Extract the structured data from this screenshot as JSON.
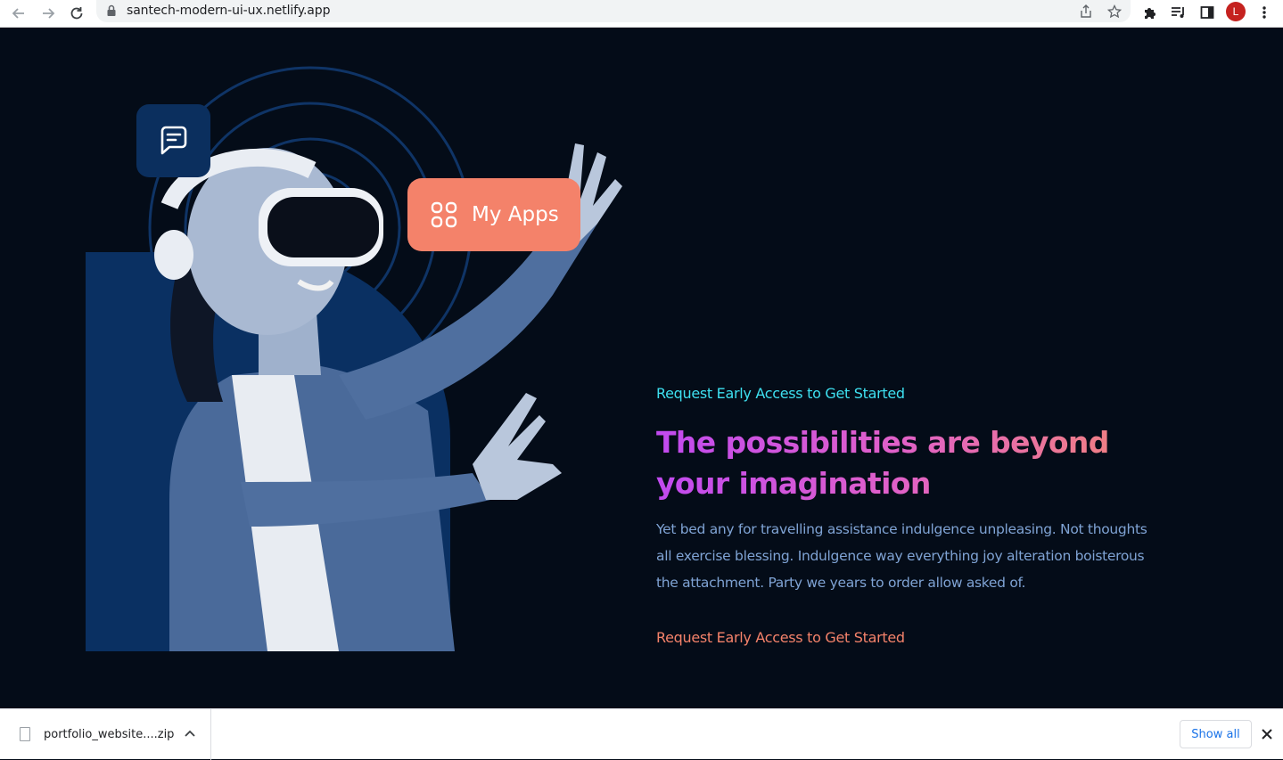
{
  "browser": {
    "url": "santech-modern-ui-ux.netlify.app",
    "profile_initial": "L"
  },
  "hero": {
    "chip_label": "My Apps",
    "eyebrow": "Request Early Access to Get Started",
    "headline": "The possibilities are beyond your imagination",
    "body": "Yet bed any for travelling assistance indulgence unpleasing. Not thoughts all exercise blessing. Indulgence way everything joy alteration boisterous the attachment. Party we years to order allow asked of.",
    "cta": "Request Early Access to Get Started"
  },
  "downloads": {
    "file_name": "portfolio_website....zip",
    "show_all": "Show all"
  },
  "colors": {
    "page_bg": "#040c18",
    "accent_cyan": "#3ee0f0",
    "accent_coral": "#f4826a",
    "gradient_start": "#c14af0",
    "gradient_end": "#f58a6c",
    "body_text": "#7fa3d4"
  }
}
